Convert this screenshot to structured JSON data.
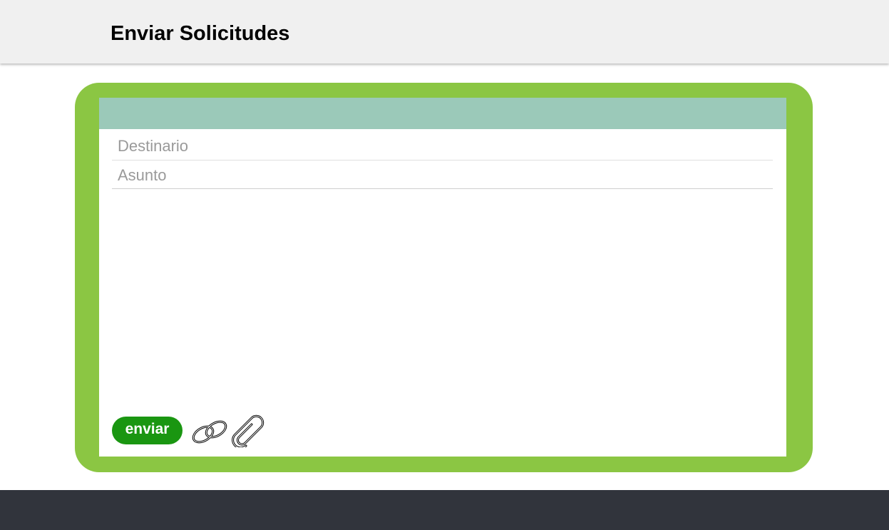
{
  "header": {
    "title": "Enviar Solicitudes"
  },
  "form": {
    "recipient_placeholder": "Destinario",
    "recipient_value": "",
    "subject_placeholder": "Asunto",
    "subject_value": "",
    "body_value": "",
    "send_label": "enviar"
  },
  "icons": {
    "link": "link-icon",
    "attach": "paperclip-icon"
  },
  "colors": {
    "frame": "#8bc643",
    "panel_header": "#9bc9b9",
    "send_button": "#1a9611",
    "footer": "#31343c",
    "topbar": "#f0f0f0"
  }
}
